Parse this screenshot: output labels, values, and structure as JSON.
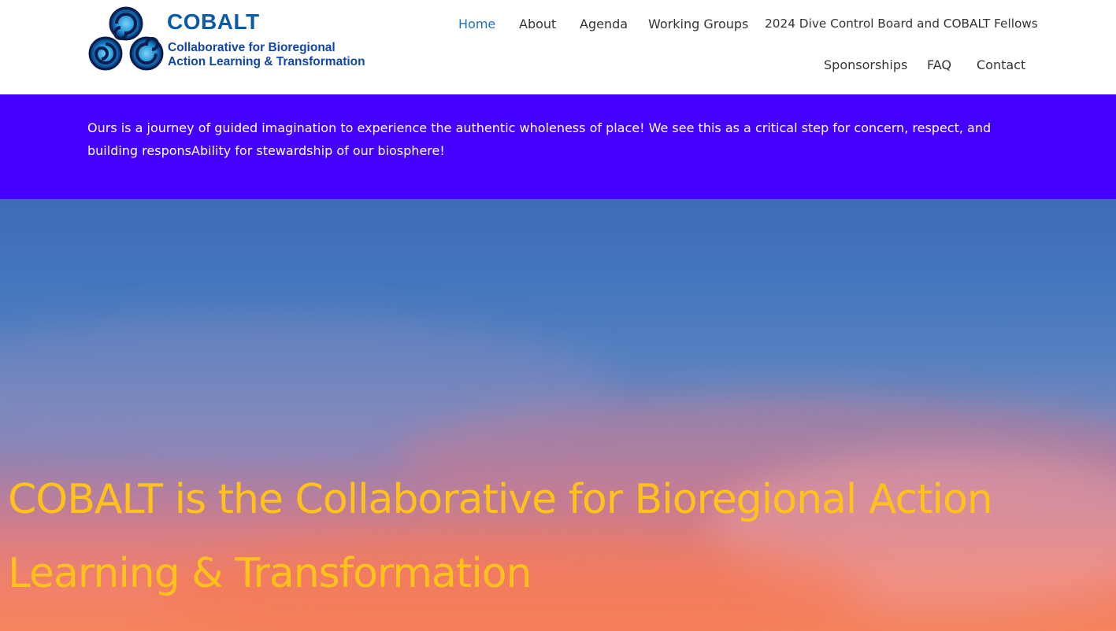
{
  "logo": {
    "title": "COBALT",
    "subtitle_line1": "Collaborative for Bioregional",
    "subtitle_line2": "Action Learning & Transformation"
  },
  "nav": {
    "items": [
      {
        "label": "Home",
        "active": true
      },
      {
        "label": "About"
      },
      {
        "label": "Agenda"
      },
      {
        "label": "Working Groups"
      },
      {
        "label": "2024 Dive Control Board and COBALT Fellows"
      },
      {
        "label": "Sponsorships"
      },
      {
        "label": "FAQ"
      },
      {
        "label": "Contact"
      }
    ]
  },
  "banner": {
    "text": "Ours is a journey of guided imagination to experience the authentic wholeness of place!  We see this as a critical step for concern, respect, and building responsAbility for stewardship of our biosphere!"
  },
  "hero": {
    "title": "COBALT is the Collaborative for Bioregional Action Learning & Transformation"
  },
  "colors": {
    "nav_active": "#1e73be",
    "nav_text": "#333333",
    "banner_bg": "#4400ff",
    "hero_title": "#ffc21a",
    "logo_blue": "#0b5aa8"
  }
}
